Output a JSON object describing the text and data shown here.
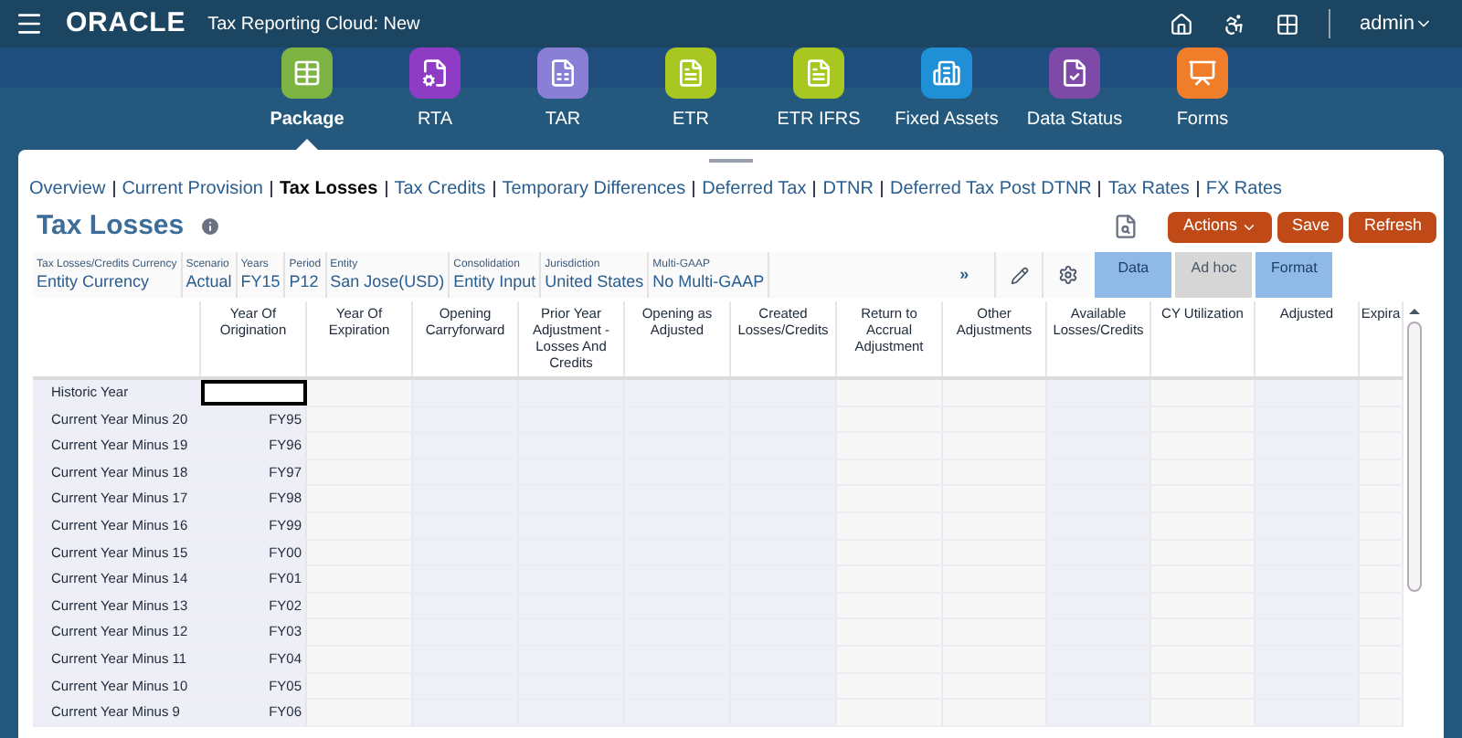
{
  "header": {
    "logo": "ORACLE",
    "app_title": "Tax Reporting Cloud: New",
    "user": "admin"
  },
  "nav": [
    {
      "label": "Package",
      "selected": true,
      "color": "#7cb342"
    },
    {
      "label": "RTA",
      "selected": false,
      "color": "#8e3cc4"
    },
    {
      "label": "TAR",
      "selected": false,
      "color": "#8a7fd6"
    },
    {
      "label": "ETR",
      "selected": false,
      "color": "#a8c821"
    },
    {
      "label": "ETR IFRS",
      "selected": false,
      "color": "#a8c821"
    },
    {
      "label": "Fixed Assets",
      "selected": false,
      "color": "#1f8fd6"
    },
    {
      "label": "Data Status",
      "selected": false,
      "color": "#7d4aa8"
    },
    {
      "label": "Forms",
      "selected": false,
      "color": "#f07d2a"
    }
  ],
  "tabs": [
    {
      "label": "Overview",
      "selected": false
    },
    {
      "label": "Current Provision",
      "selected": false
    },
    {
      "label": "Tax Losses",
      "selected": true
    },
    {
      "label": "Tax Credits",
      "selected": false
    },
    {
      "label": "Temporary Differences",
      "selected": false
    },
    {
      "label": "Deferred Tax",
      "selected": false
    },
    {
      "label": "DTNR",
      "selected": false
    },
    {
      "label": "Deferred Tax Post DTNR",
      "selected": false
    },
    {
      "label": "Tax Rates",
      "selected": false
    },
    {
      "label": "FX Rates",
      "selected": false
    }
  ],
  "page_title": "Tax Losses",
  "buttons": [
    {
      "label": "Actions",
      "kind": "menu"
    },
    {
      "label": "Save",
      "kind": "plain"
    },
    {
      "label": "Refresh",
      "kind": "plain"
    }
  ],
  "pov": [
    {
      "label": "Tax Losses/Credits Currency",
      "value": "Entity Currency"
    },
    {
      "label": "Scenario",
      "value": "Actual"
    },
    {
      "label": "Years",
      "value": "FY15"
    },
    {
      "label": "Period",
      "value": "P12"
    },
    {
      "label": "Entity",
      "value": "San Jose(USD)"
    },
    {
      "label": "Consolidation",
      "value": "Entity Input"
    },
    {
      "label": "Jurisdiction",
      "value": "United States"
    },
    {
      "label": "Multi-GAAP",
      "value": "No Multi-GAAP"
    }
  ],
  "pov_more": "»",
  "modes": [
    {
      "label": "Data",
      "disabled": false
    },
    {
      "label": "Ad hoc",
      "disabled": true
    },
    {
      "label": "Format",
      "disabled": false
    }
  ],
  "table": {
    "columns": [
      "Year Of Origination",
      "Year Of Expiration",
      "Opening Carryforward",
      "Prior Year Adjustment - Losses And Credits",
      "Opening as Adjusted",
      "Created Losses/Credits",
      "Return to Accrual Adjustment",
      "Other Adjustments",
      "Available Losses/Credits",
      "CY Utilization",
      "Adjusted",
      "Expira"
    ],
    "rows": [
      {
        "label": "Historic Year",
        "origination": "",
        "selected": true
      },
      {
        "label": "Current Year Minus 20",
        "origination": "FY95",
        "selected": false
      },
      {
        "label": "Current Year Minus 19",
        "origination": "FY96",
        "selected": false
      },
      {
        "label": "Current Year Minus 18",
        "origination": "FY97",
        "selected": false
      },
      {
        "label": "Current Year Minus 17",
        "origination": "FY98",
        "selected": false
      },
      {
        "label": "Current Year Minus 16",
        "origination": "FY99",
        "selected": false
      },
      {
        "label": "Current Year Minus 15",
        "origination": "FY00",
        "selected": false
      },
      {
        "label": "Current Year Minus 14",
        "origination": "FY01",
        "selected": false
      },
      {
        "label": "Current Year Minus 13",
        "origination": "FY02",
        "selected": false
      },
      {
        "label": "Current Year Minus 12",
        "origination": "FY03",
        "selected": false
      },
      {
        "label": "Current Year Minus 11",
        "origination": "FY04",
        "selected": false
      },
      {
        "label": "Current Year Minus 10",
        "origination": "FY05",
        "selected": false
      },
      {
        "label": "Current Year Minus 9",
        "origination": "FY06",
        "selected": false
      }
    ]
  }
}
